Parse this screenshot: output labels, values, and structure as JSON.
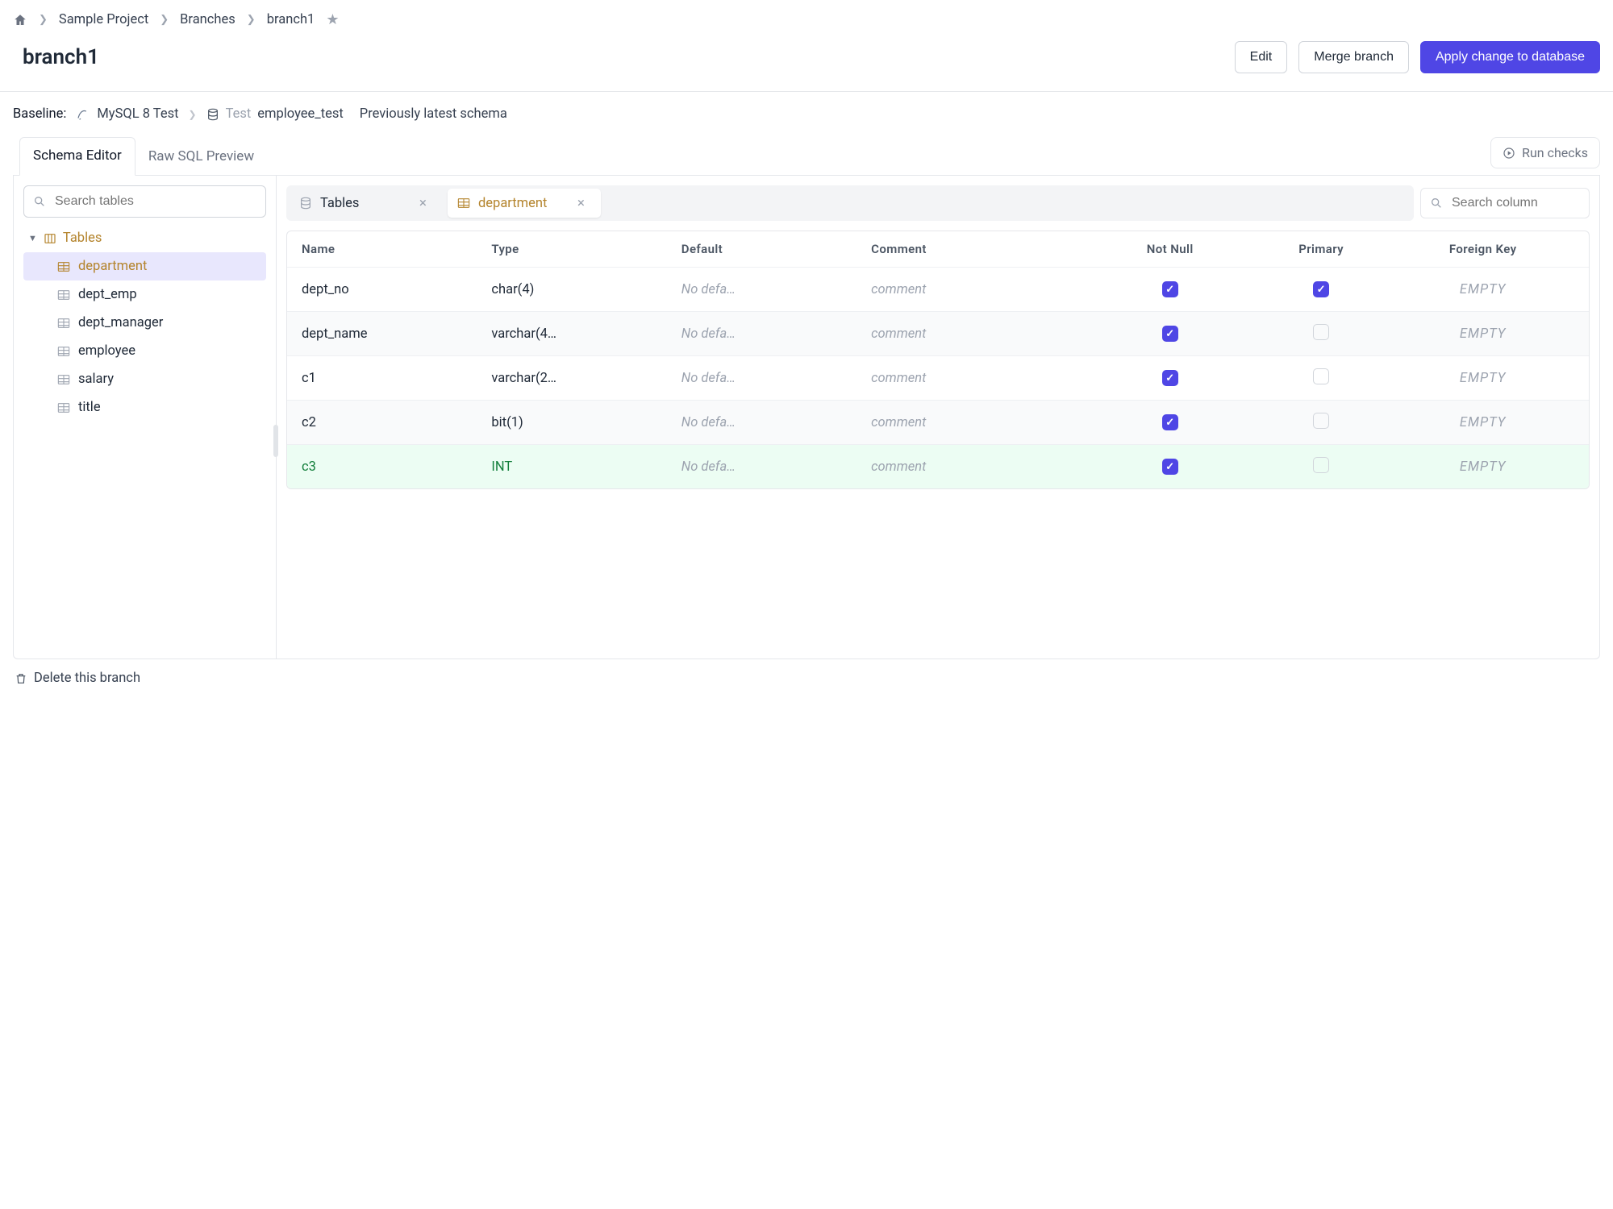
{
  "breadcrumb": {
    "items": [
      "Sample Project",
      "Branches",
      "branch1"
    ]
  },
  "page": {
    "title": "branch1"
  },
  "actions": {
    "edit": "Edit",
    "merge": "Merge branch",
    "apply": "Apply change to database"
  },
  "baseline": {
    "label": "Baseline:",
    "instance": "MySQL 8 Test",
    "context": "Test",
    "database": "employee_test",
    "note": "Previously latest schema"
  },
  "tabs": {
    "schema": "Schema Editor",
    "raw": "Raw SQL Preview",
    "runChecks": "Run checks"
  },
  "sidebar": {
    "searchPlaceholder": "Search tables",
    "rootLabel": "Tables",
    "items": [
      {
        "label": "department",
        "selected": true
      },
      {
        "label": "dept_emp"
      },
      {
        "label": "dept_manager"
      },
      {
        "label": "employee"
      },
      {
        "label": "salary"
      },
      {
        "label": "title"
      }
    ]
  },
  "openTabs": [
    {
      "kind": "db",
      "label": "Tables",
      "active": false
    },
    {
      "kind": "table",
      "label": "department",
      "active": true
    }
  ],
  "columnSearchPlaceholder": "Search column",
  "columnsHeader": {
    "name": "Name",
    "type": "Type",
    "default": "Default",
    "comment": "Comment",
    "notNull": "Not Null",
    "primary": "Primary",
    "fk": "Foreign Key"
  },
  "columns": [
    {
      "name": "dept_no",
      "type": "char(4)",
      "default": "No defa…",
      "comment": "comment",
      "notNull": true,
      "primary": true,
      "fk": "EMPTY",
      "alt": false,
      "new": false
    },
    {
      "name": "dept_name",
      "type": "varchar(4…",
      "default": "No defa…",
      "comment": "comment",
      "notNull": true,
      "primary": false,
      "fk": "EMPTY",
      "alt": true,
      "new": false
    },
    {
      "name": "c1",
      "type": "varchar(2…",
      "default": "No defa…",
      "comment": "comment",
      "notNull": true,
      "primary": false,
      "fk": "EMPTY",
      "alt": false,
      "new": false
    },
    {
      "name": "c2",
      "type": "bit(1)",
      "default": "No defa…",
      "comment": "comment",
      "notNull": true,
      "primary": false,
      "fk": "EMPTY",
      "alt": true,
      "new": false
    },
    {
      "name": "c3",
      "type": "INT",
      "default": "No defa…",
      "comment": "comment",
      "notNull": true,
      "primary": false,
      "fk": "EMPTY",
      "alt": false,
      "new": true
    }
  ],
  "footer": {
    "delete": "Delete this branch"
  },
  "colors": {
    "primary": "#4f46e5",
    "accent": "#b4842d",
    "success": "#15803d"
  }
}
